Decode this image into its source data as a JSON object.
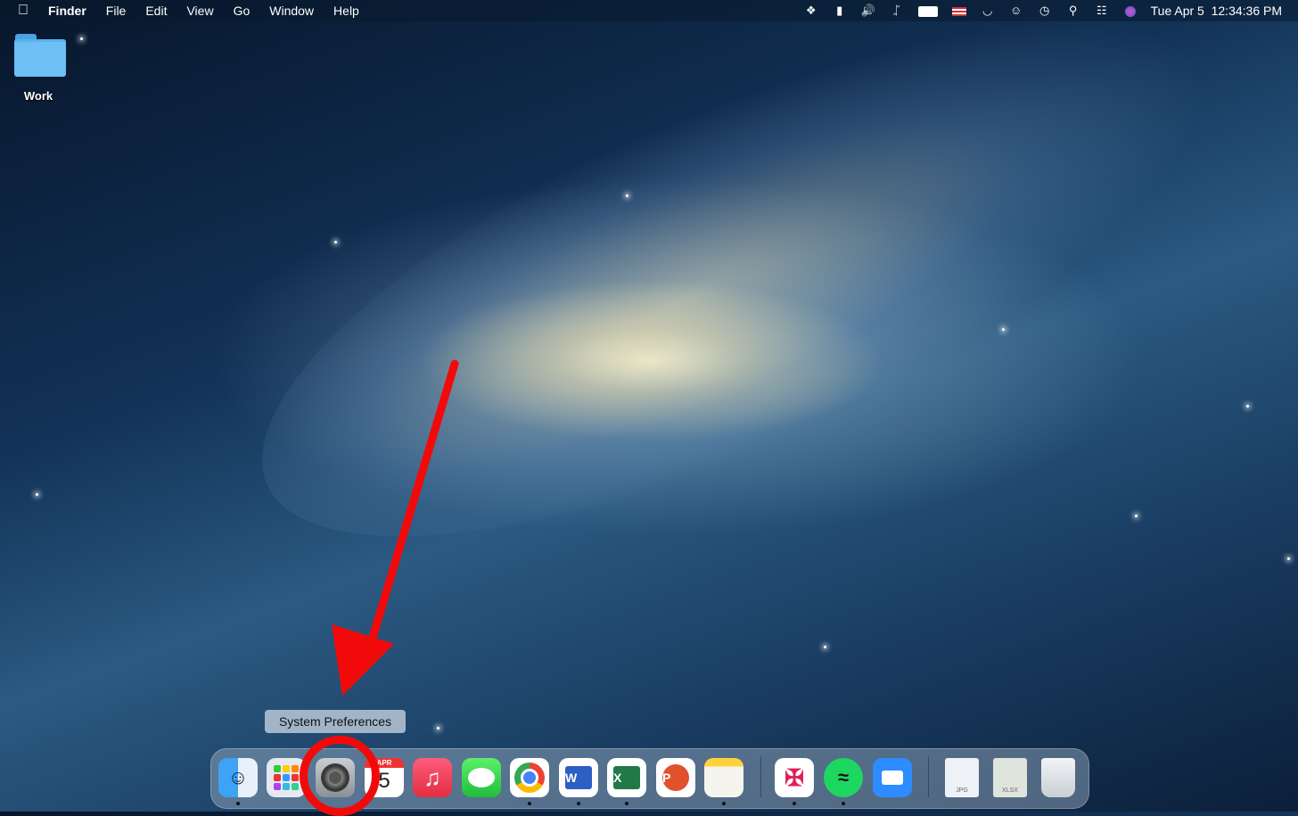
{
  "menubar": {
    "apple": "",
    "app_name": "Finder",
    "menus": [
      "File",
      "Edit",
      "View",
      "Go",
      "Window",
      "Help"
    ],
    "status_icons": [
      "dropbox-icon",
      "contacts-icon",
      "volume-icon",
      "bluetooth-icon",
      "battery-icon",
      "us-flag-input-icon",
      "wifi-icon",
      "user-icon",
      "time-machine-icon",
      "spotlight-search-icon",
      "control-center-icon",
      "siri-icon"
    ],
    "clock": "Tue Apr 5  12:34:36 PM"
  },
  "desktop": {
    "folder_label": "Work"
  },
  "tooltip": "System Preferences",
  "calendar": {
    "month": "APR",
    "day": "5"
  },
  "dock": {
    "apps": [
      {
        "name": "Finder",
        "running": true
      },
      {
        "name": "Launchpad",
        "running": false
      },
      {
        "name": "System Preferences",
        "running": false
      },
      {
        "name": "Calendar",
        "running": false
      },
      {
        "name": "Music",
        "running": false
      },
      {
        "name": "Messages",
        "running": false
      },
      {
        "name": "Google Chrome",
        "running": true
      },
      {
        "name": "Microsoft Word",
        "running": true
      },
      {
        "name": "Microsoft Excel",
        "running": true
      },
      {
        "name": "Microsoft PowerPoint",
        "running": false
      },
      {
        "name": "Notes",
        "running": true
      },
      {
        "name": "Slack",
        "running": true
      },
      {
        "name": "Spotify",
        "running": true
      },
      {
        "name": "Zoom",
        "running": false
      }
    ],
    "files": [
      {
        "name": "JPG document",
        "ext": "JPG"
      },
      {
        "name": "XLSX document",
        "ext": "XLSX"
      }
    ],
    "trash": "Trash"
  }
}
